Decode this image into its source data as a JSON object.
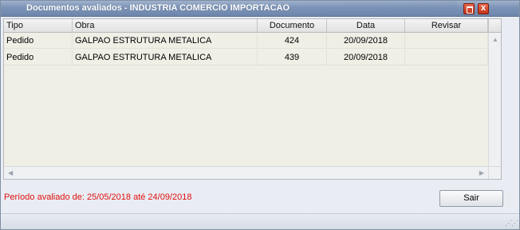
{
  "window": {
    "title": "Documentos avaliados - INDUSTRIA COMERCIO IMPORTACAO",
    "maximize_icon": "maximize-icon",
    "close_icon": "close-icon"
  },
  "table": {
    "columns": [
      "Tipo",
      "Obra",
      "Documento",
      "Data",
      "Revisar"
    ],
    "rows": [
      {
        "tipo": "Pedido",
        "obra": "GALPAO ESTRUTURA METALICA",
        "documento": "424",
        "data": "20/09/2018",
        "revisar": ""
      },
      {
        "tipo": "Pedido",
        "obra": "GALPAO ESTRUTURA METALICA",
        "documento": "439",
        "data": "20/09/2018",
        "revisar": ""
      }
    ]
  },
  "footer": {
    "period_text": "Período avaliado de: 25/05/2018 até 24/09/2018",
    "exit_label": "Sair"
  },
  "colors": {
    "title_bar": "#7c93b6",
    "period_text": "#e01010",
    "grid_background": "#f0efe6"
  }
}
